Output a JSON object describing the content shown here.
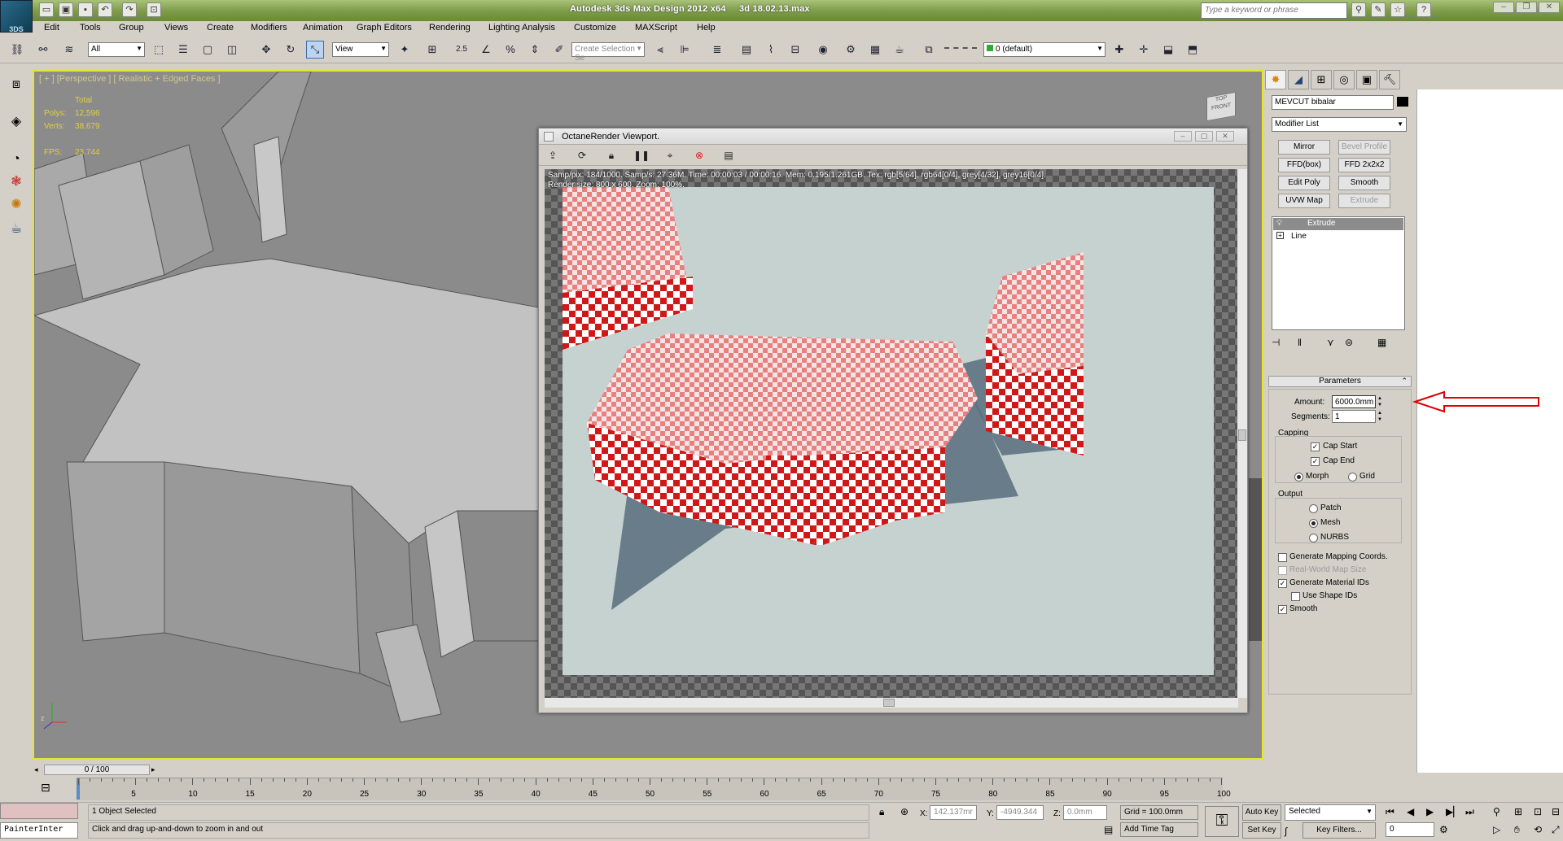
{
  "app": {
    "title": "Autodesk 3ds Max Design 2012 x64",
    "file": "3d 18.02.13.max",
    "logo_text": "3DS",
    "search_placeholder": "Type a keyword or phrase"
  },
  "menus": [
    "Edit",
    "Tools",
    "Group",
    "Views",
    "Create",
    "Modifiers",
    "Animation",
    "Graph Editors",
    "Rendering",
    "Lighting Analysis",
    "Customize",
    "MAXScript",
    "Help"
  ],
  "toolbar": {
    "selection_filter": "All",
    "ref_coord": "View",
    "snap_label": "2.5",
    "named_selection_placeholder": "Create Selection Se",
    "layer": "0 (default)"
  },
  "viewport": {
    "label": "[ + ] [Perspective ] [ Realistic + Edged Faces ]",
    "stats": {
      "total_label": "Total",
      "polys_label": "Polys:",
      "polys": "12,596",
      "verts_label": "Verts:",
      "verts": "38,679",
      "fps_label": "FPS:",
      "fps": "23.744"
    },
    "viewcube_top": "TOP",
    "viewcube_front": "FRONT"
  },
  "octane": {
    "title": "OctaneRender Viewport.",
    "info_line1": "Samp/pix: 184/1000.   Samp/s: 27.36M.   Time: 00:00:03 / 00:00:16.   Mem: 0.195/1.261GB.   Tex: rgb[5/64], rgb64[0/4], grey[4/32], grey16[0/4].",
    "info_line2": "Render size: 800 x 600.   Zoom: 100%."
  },
  "command_panel": {
    "object_name": "MEVCUT bibalar",
    "modifier_list": "Modifier List",
    "buttons": [
      {
        "label": "Mirror",
        "enabled": true
      },
      {
        "label": "Bevel Profile",
        "enabled": false
      },
      {
        "label": "FFD(box)",
        "enabled": true
      },
      {
        "label": "FFD 2x2x2",
        "enabled": true
      },
      {
        "label": "Edit Poly",
        "enabled": true
      },
      {
        "label": "Smooth",
        "enabled": true
      },
      {
        "label": "UVW Map",
        "enabled": true
      },
      {
        "label": "Extrude",
        "enabled": false
      }
    ],
    "stack": [
      "Extrude",
      "Line"
    ],
    "rollout_title": "Parameters",
    "amount_label": "Amount:",
    "amount_value": "6000.0mm",
    "segments_label": "Segments:",
    "segments_value": "1",
    "capping_label": "Capping",
    "cap_start": "Cap Start",
    "cap_end": "Cap End",
    "morph": "Morph",
    "grid": "Grid",
    "output_label": "Output",
    "patch": "Patch",
    "mesh": "Mesh",
    "nurbs": "NURBS",
    "gen_mapping": "Generate Mapping Coords.",
    "real_world": "Real-World Map Size",
    "gen_material": "Generate Material IDs",
    "use_shape": "Use Shape IDs",
    "smooth": "Smooth"
  },
  "timeline": {
    "slider": "0 / 100",
    "ticks": [
      "5",
      "10",
      "15",
      "20",
      "25",
      "30",
      "35",
      "40",
      "45",
      "50",
      "55",
      "60",
      "65",
      "70",
      "75",
      "80",
      "85",
      "90",
      "95",
      "100"
    ]
  },
  "status": {
    "script_label": "PainterInter",
    "selection": "1 Object Selected",
    "prompt": "Click and drag up-and-down to zoom in and out",
    "x_label": "X:",
    "x": "142.137mr",
    "y_label": "Y:",
    "y": "-4949.344",
    "z_label": "Z:",
    "z": "0.0mm",
    "grid": "Grid = 100.0mm",
    "add_time_tag": "Add Time Tag",
    "auto_key": "Auto Key",
    "set_key": "Set Key",
    "key_mode": "Selected",
    "key_filters": "Key Filters...",
    "frame": "0"
  },
  "colors": {
    "viewport_border": "#e8e42a",
    "annotation_arrow": "#e00000",
    "title_bar": "#7f9d4a"
  }
}
